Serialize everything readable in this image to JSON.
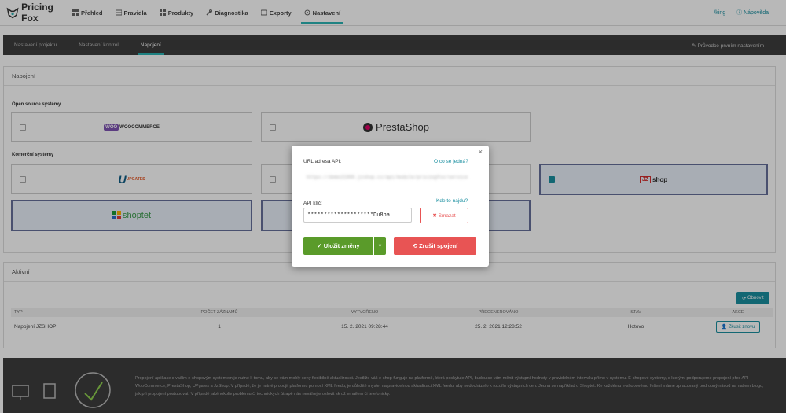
{
  "app": {
    "name": "Pricing Fox"
  },
  "nav": {
    "items": [
      {
        "label": "Přehled"
      },
      {
        "label": "Pravidla"
      },
      {
        "label": "Produkty"
      },
      {
        "label": "Diagnostika"
      },
      {
        "label": "Exporty"
      },
      {
        "label": "Nastavení"
      }
    ],
    "active_index": 5,
    "right": {
      "user": "/king",
      "help": "Nápověda"
    }
  },
  "subnav": {
    "tabs": [
      "Nastavení projektu",
      "Nastavení kontrol",
      "Napojení"
    ],
    "active_index": 2,
    "guide": "Průvodce prvním nastavením"
  },
  "connections": {
    "title": "Napojení",
    "open_source_label": "Open source systémy",
    "commercial_label": "Komerční systémy",
    "logos": {
      "woocommerce": "WOOCOMMERCE",
      "prestashop": "PrestaShop",
      "upgates": "UPGATES",
      "jzshop": "shop",
      "jzshop_mark": "JZ",
      "shoptet": "shoptet"
    }
  },
  "modal": {
    "url_label": "URL adresa API:",
    "url_help": "O co se jedná?",
    "url_value": "https://demo21900.jzshop.cz/api/module/pricingfox/service",
    "key_label": "API klíč:",
    "key_help": "Kde to najdu?",
    "key_value": "********************Du8ha",
    "delete_label": "Smazat",
    "save_label": "Uložit změny",
    "cancel_label": "Zrušit spojení",
    "close": "×"
  },
  "active": {
    "title": "Aktivní",
    "refresh_label": "Obnovit",
    "columns": [
      "TYP",
      "POČET ZÁZNAMŮ",
      "VYTVOŘENO",
      "PŘEGENEROVÁNO",
      "STAV",
      "AKCE"
    ],
    "rows": [
      {
        "type": "Napojení JZSHOP",
        "count": "1",
        "created": "15. 2. 2021 09:28:44",
        "regenerated": "25. 2. 2021 12:28:52",
        "status": "Hotovo",
        "action": "Zkusit znovu"
      }
    ]
  },
  "footer": {
    "text": "Propojení aplikace s vaším e-shopovým systémem je nutné k tomu, aby se vám mohly ceny flexibilně aktualizovat. Jestliže váš e-shop funguje na platformě, která poskytuje API, budou se vám měnit výstupní hodnoty v pravidelném intervalu přímo v systému. E-shopové systémy, s kterými podporujeme propojení přes API – WooCommerce, PrestaShop, UPgates a JzShop. V případě, že je nutné propojit platformu pomocí XML feedu, je důležité myslet na pravidelnou aktualizaci XML feedu, aby nedocházelo k rozdílu výstupních cen. Jedná se například o Shoptet. Ke každému e-shopovému řešení máme zpracovaný podrobný návod na našem blogu, jak při propojení postupovat. V případě jakéhokoliv problému či technických útrapě nás neváhejte oslovit sk už emailem či telefonicky."
  },
  "colors": {
    "accent": "#2bb5b5",
    "save": "#5a9b2a",
    "danger": "#e85454",
    "link": "#1a8fa0"
  }
}
